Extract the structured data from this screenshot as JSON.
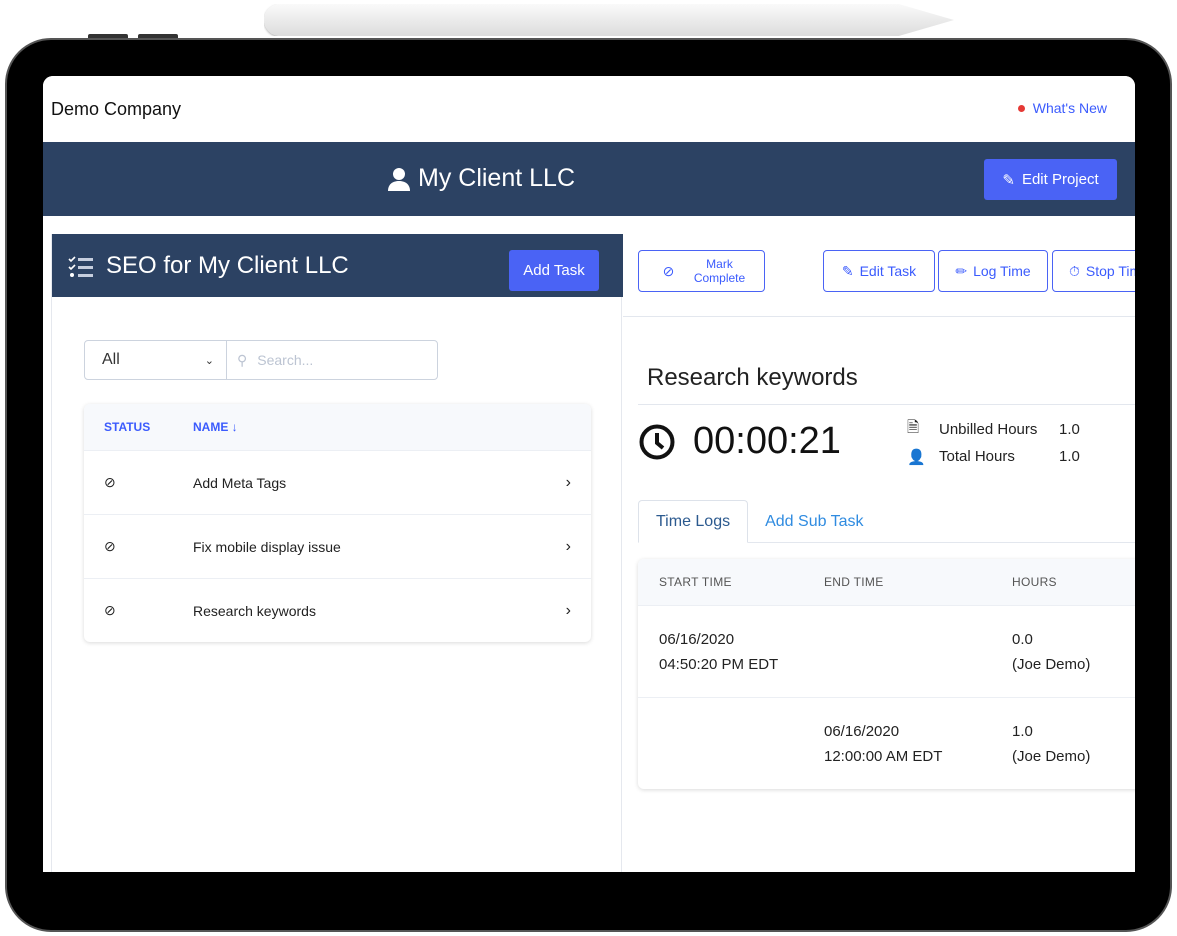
{
  "header": {
    "company": "Demo Company",
    "whats_new": "What's New"
  },
  "project": {
    "title": "My Client LLC",
    "edit_label": "Edit Project"
  },
  "task_list": {
    "title": "SEO for My Client LLC",
    "add_label": "Add Task",
    "filter_value": "All",
    "search_placeholder": "Search...",
    "columns": {
      "status": "STATUS",
      "name": "NAME ↓"
    },
    "rows": [
      {
        "name": "Add Meta Tags"
      },
      {
        "name": "Fix mobile display issue"
      },
      {
        "name": "Research keywords"
      }
    ]
  },
  "task": {
    "mark_complete": "Mark Complete",
    "edit_task": "Edit Task",
    "log_time": "Log Time",
    "stop_timer": "Stop Timer",
    "title": "Research keywords",
    "timer": "00:00:21",
    "unbilled_label": "Unbilled Hours",
    "unbilled_value": "1.0",
    "total_label": "Total Hours",
    "total_value": "1.0",
    "tabs": [
      "Time Logs",
      "Add Sub Task"
    ],
    "log_columns": {
      "start": "START TIME",
      "end": "END TIME",
      "hours": "HOURS"
    },
    "logs": [
      {
        "start_date": "06/16/2020",
        "start_time": "04:50:20 PM EDT",
        "end_date": "",
        "end_time": "",
        "hours": "0.0",
        "user": "(Joe Demo)"
      },
      {
        "start_date": "",
        "start_time": "",
        "end_date": "06/16/2020",
        "end_time": "12:00:00 AM EDT",
        "hours": "1.0",
        "user": "(Joe Demo)"
      }
    ]
  },
  "colors": {
    "navy": "#2c4263",
    "accent": "#4a63f5",
    "link": "#3b5bfd"
  }
}
